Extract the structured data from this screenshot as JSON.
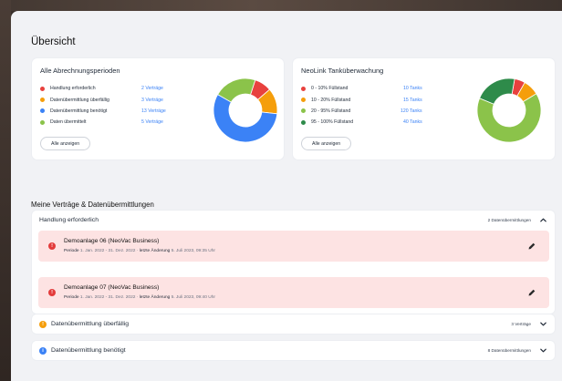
{
  "page": {
    "title": "Übersicht",
    "section_title": "Meine Verträge & Datenübermittlungen"
  },
  "billing_card": {
    "title": "Alle Abrechnungsperioden",
    "button": "Alle anzeigen",
    "items": [
      {
        "label": "Handlung erforderlich",
        "count": "2 Verträge",
        "color": "#e8413e"
      },
      {
        "label": "Datenübermittlung überfällig",
        "count": "3 Verträge",
        "color": "#f59e0b"
      },
      {
        "label": "Datenübermittlung benötigt",
        "count": "13 Verträge",
        "color": "#3b82f6"
      },
      {
        "label": "Daten übermittelt",
        "count": "5 Verträge",
        "color": "#8bc34a"
      }
    ]
  },
  "tank_card": {
    "title": "NeoLink Tanküberwachung",
    "button": "Alle anzeigen",
    "items": [
      {
        "label": "0 - 10% Füllstand",
        "count": "10 Tanks",
        "color": "#e8413e"
      },
      {
        "label": "10 - 20% Füllstand",
        "count": "15 Tanks",
        "color": "#f59e0b"
      },
      {
        "label": "20 - 95% Füllstand",
        "count": "120 Tanks",
        "color": "#8bc34a"
      },
      {
        "label": "95 - 100% Füllstand",
        "count": "40 Tanks",
        "color": "#2e8b4a"
      }
    ]
  },
  "donut_billing": {
    "values": [
      2,
      3,
      13,
      5
    ],
    "colors": [
      "#e8413e",
      "#f59e0b",
      "#3b82f6",
      "#8bc34a"
    ],
    "start_deg": 18
  },
  "donut_tank": {
    "values": [
      10,
      15,
      120,
      40
    ],
    "colors": [
      "#e8413e",
      "#f59e0b",
      "#8bc34a",
      "#2e8b4a"
    ],
    "start_deg": 10
  },
  "groups": [
    {
      "label": "Handlung erforderlich",
      "count": "2 Datenübermittlungen",
      "expanded": true,
      "items": [
        {
          "name": "Demoanlage 06 (NeoVac Business)",
          "period_label": "Periode",
          "period": "1. Jan. 2022 - 31. Dez. 2022",
          "sep": "·",
          "changed_label": "letzte Änderung",
          "changed": "5. Juli 2023, 09:35 Uhr"
        },
        {
          "name": "Demoanlage 07 (NeoVac Business)",
          "period_label": "Periode",
          "period": "1. Jan. 2022 - 31. Dez. 2022",
          "sep": "·",
          "changed_label": "letzte Änderung",
          "changed": "5. Juli 2023, 09:40 Uhr"
        }
      ]
    },
    {
      "label": "Datenübermittlung überfällig",
      "count": "3 Verträge",
      "color": "#f59e0b",
      "glyph": "!"
    },
    {
      "label": "Datenübermittlung benötigt",
      "count": "8 Datenübermittlungen",
      "color": "#3b82f6",
      "glyph": "i"
    }
  ]
}
